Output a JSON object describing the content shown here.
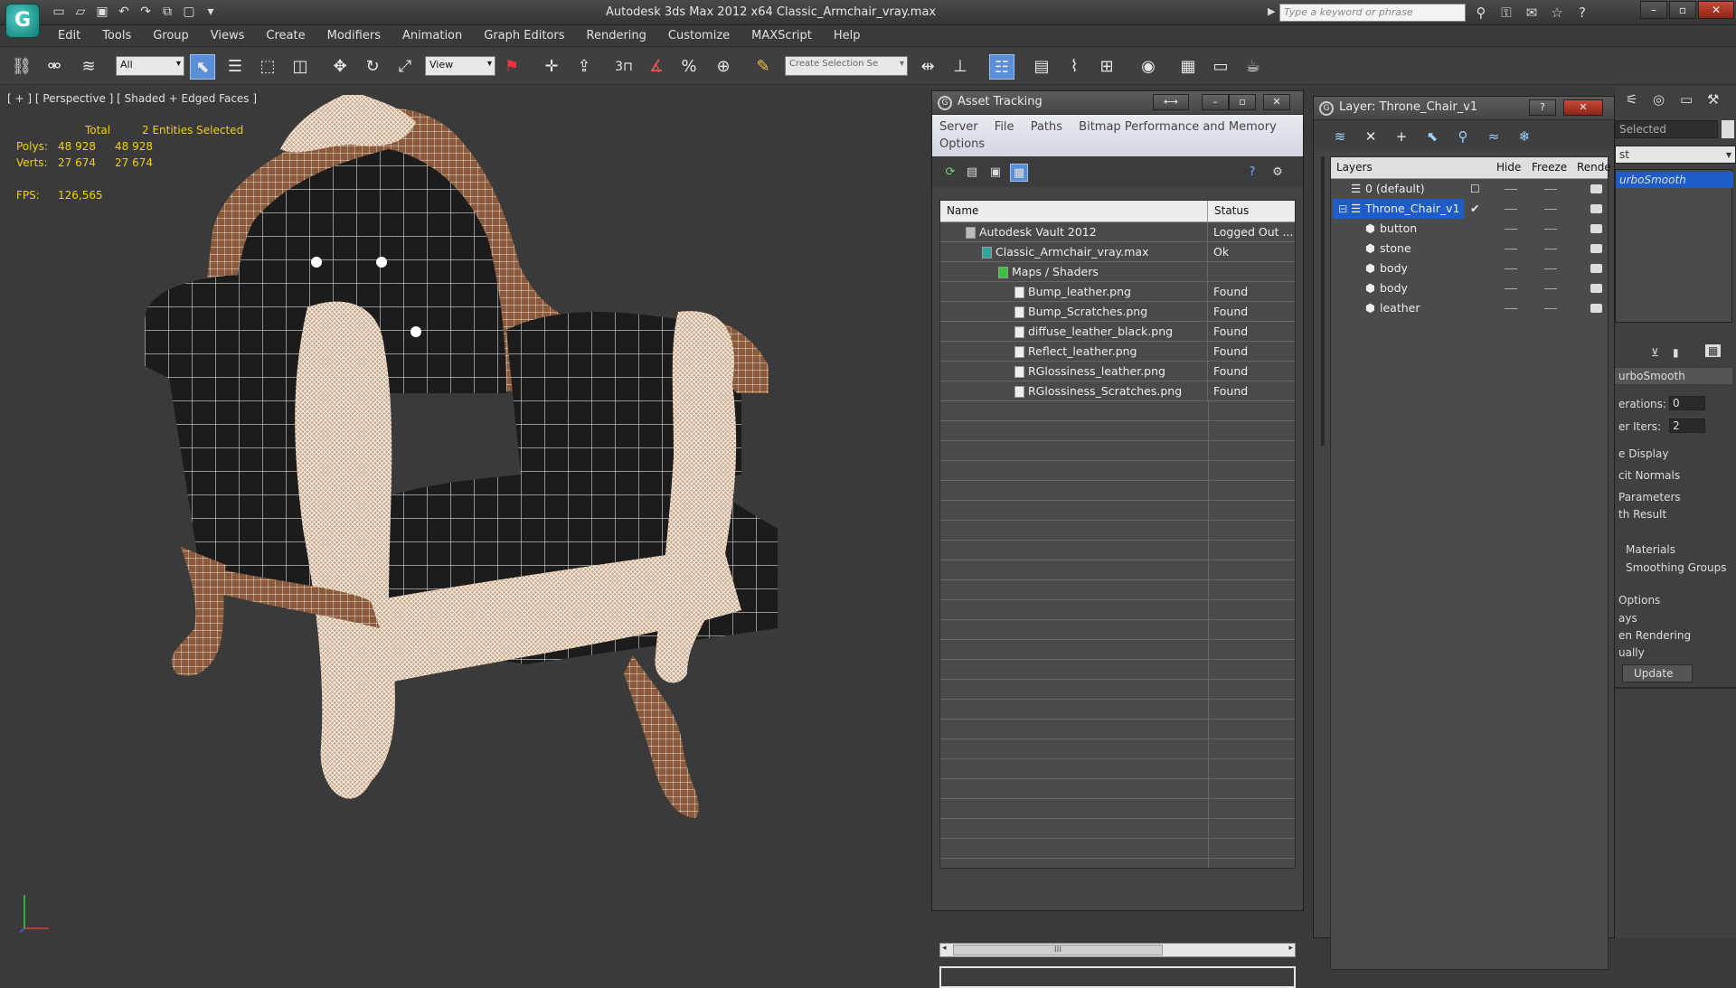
{
  "app": {
    "title": "Autodesk 3ds Max  2012 x64      Classic_Armchair_vray.max",
    "logo_letter": "G",
    "search_placeholder": "Type a keyword or phrase"
  },
  "menu": [
    "Edit",
    "Tools",
    "Group",
    "Views",
    "Create",
    "Modifiers",
    "Animation",
    "Graph Editors",
    "Rendering",
    "Customize",
    "MAXScript",
    "Help"
  ],
  "toolbar": {
    "filter_value": "All",
    "ref_coord_value": "View",
    "selection_set_placeholder": "Create Selection Se",
    "snap_label": "3"
  },
  "viewport": {
    "label": "[ + ] [ Perspective ] [ Shaded + Edged Faces ]",
    "stats_header_total": "Total",
    "stats_header_selected": "2 Entities Selected",
    "polys_label": "Polys:",
    "polys_total": "48 928",
    "polys_selected": "48 928",
    "verts_label": "Verts:",
    "verts_total": "27 674",
    "verts_selected": "27 674",
    "fps_label": "FPS:",
    "fps_value": "126,565"
  },
  "asset_tracking": {
    "title": "Asset Tracking",
    "menu": [
      "Server",
      "File",
      "Paths",
      "Bitmap Performance and Memory",
      "Options"
    ],
    "col_name": "Name",
    "col_status": "Status",
    "rows": [
      {
        "name": "Autodesk Vault 2012",
        "status": "Logged Out ..."
      },
      {
        "name": "Classic_Armchair_vray.max",
        "status": "Ok"
      },
      {
        "name": "Maps / Shaders",
        "status": ""
      },
      {
        "name": "Bump_leather.png",
        "status": "Found"
      },
      {
        "name": "Bump_Scratches.png",
        "status": "Found"
      },
      {
        "name": "diffuse_leather_black.png",
        "status": "Found"
      },
      {
        "name": "Reflect_leather.png",
        "status": "Found"
      },
      {
        "name": "RGlossiness_leather.png",
        "status": "Found"
      },
      {
        "name": "RGlossiness_Scratches.png",
        "status": "Found"
      }
    ],
    "scroll_thumb": "III"
  },
  "layer_panel": {
    "title": "Layer: Throne_Chair_v1",
    "col_layers": "Layers",
    "col_hide": "Hide",
    "col_freeze": "Freeze",
    "col_render": "Rende",
    "rows": [
      {
        "name": "0 (default)"
      },
      {
        "name": "Throne_Chair_v1"
      },
      {
        "name": "button"
      },
      {
        "name": "stone"
      },
      {
        "name": "body"
      },
      {
        "name": "body"
      },
      {
        "name": "leather"
      }
    ]
  },
  "command_panel": {
    "selected_label": "Selected",
    "list_label": "st",
    "modifier": "urboSmooth",
    "rollout_title": "urboSmooth",
    "iterations_label": "erations:",
    "iterations_value": "0",
    "render_iters_label": "er Iters:",
    "render_iters_value": "2",
    "isoline_label": "e Display",
    "explicit_normals_label": "cit Normals",
    "params_label": "Parameters",
    "smooth_result_label": "th Result",
    "materials_label": "Materials",
    "smoothing_groups_label": "Smoothing Groups",
    "options_label": "Options",
    "always_label": "ays",
    "when_rendering_label": "en Rendering",
    "manually_label": "ually",
    "update_label": "Update"
  },
  "colors": {
    "accent_teal": "#1fa39a",
    "yellow_stats": "#f0d200",
    "selection_blue": "#1e5cc8"
  }
}
